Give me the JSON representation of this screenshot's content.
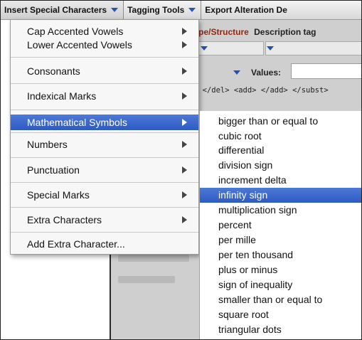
{
  "menubar": {
    "menus": [
      {
        "label": "Insert Special Characters"
      },
      {
        "label": "Tagging Tools"
      },
      {
        "label": "Export Alteration De"
      }
    ]
  },
  "background": {
    "header_type": "Type/Structure",
    "header_desc": "Description tag",
    "values_label": "Values:",
    "xml_snippet": "> </del> <add> </add> </subst>"
  },
  "dropdown": {
    "items": [
      {
        "label": "Cap Accented Vowels",
        "has_submenu": true
      },
      {
        "label": "Lower Accented Vowels",
        "has_submenu": true
      },
      {
        "label": "Consonants",
        "has_submenu": true
      },
      {
        "label": "Indexical Marks",
        "has_submenu": true
      },
      {
        "label": "Mathematical Symbols",
        "has_submenu": true,
        "selected": true
      },
      {
        "label": "Numbers",
        "has_submenu": true
      },
      {
        "label": "Punctuation",
        "has_submenu": true
      },
      {
        "label": "Special Marks",
        "has_submenu": true
      },
      {
        "label": "Extra Characters",
        "has_submenu": true
      },
      {
        "label": "Add Extra Character...",
        "has_submenu": false
      }
    ]
  },
  "submenu": {
    "items": [
      {
        "label": "bigger than or equal to"
      },
      {
        "label": "cubic root"
      },
      {
        "label": "differential"
      },
      {
        "label": "division sign"
      },
      {
        "label": "increment delta"
      },
      {
        "label": "infinity sign",
        "selected": true
      },
      {
        "label": "multiplication sign"
      },
      {
        "label": "percent"
      },
      {
        "label": "per mille"
      },
      {
        "label": "per ten thousand"
      },
      {
        "label": "plus or minus"
      },
      {
        "label": "sign of inequality"
      },
      {
        "label": "smaller than or equal to"
      },
      {
        "label": "square root"
      },
      {
        "label": "triangular dots"
      }
    ]
  },
  "colors": {
    "highlight": "#3366cc",
    "caret": "#2255b8",
    "header_accent": "#8a2b12"
  }
}
